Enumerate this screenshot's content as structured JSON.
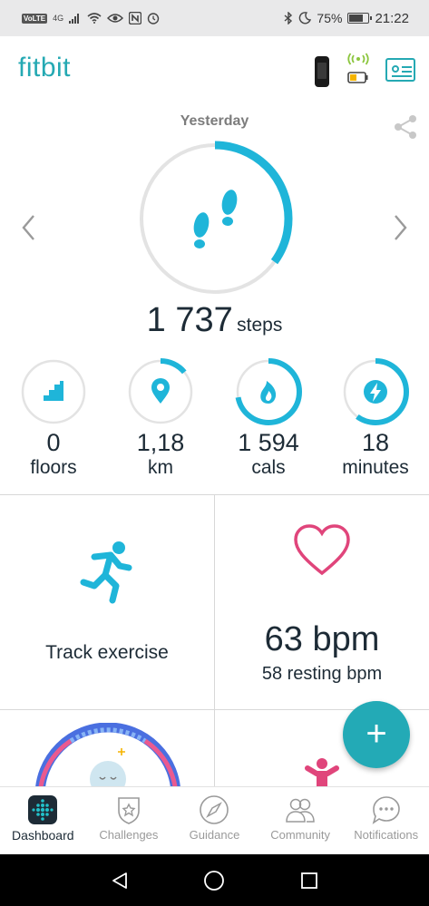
{
  "status_bar": {
    "volte": "VoLTE",
    "network": "4G",
    "battery_percent": "75%",
    "battery_level": 0.75,
    "time": "21:22"
  },
  "app": {
    "logo": "fitbit",
    "brand_color": "#25a9b3"
  },
  "summary": {
    "period": "Yesterday",
    "steps_value": "1 737",
    "steps_unit": "steps",
    "steps_progress": 0.35
  },
  "stats": [
    {
      "value": "0",
      "unit": "floors",
      "icon": "stairs-icon",
      "progress": 0.0
    },
    {
      "value": "1,18",
      "unit": "km",
      "icon": "location-pin-icon",
      "progress": 0.14
    },
    {
      "value": "1 594",
      "unit": "cals",
      "icon": "flame-icon",
      "progress": 0.72
    },
    {
      "value": "18",
      "unit": "minutes",
      "icon": "lightning-icon",
      "progress": 0.6
    }
  ],
  "tiles": {
    "exercise_label": "Track exercise",
    "heart_bpm": "63 bpm",
    "heart_resting": "58 resting bpm"
  },
  "fab": {
    "label": "+"
  },
  "bottom_nav": [
    {
      "label": "Dashboard",
      "icon": "dashboard-icon",
      "active": true
    },
    {
      "label": "Challenges",
      "icon": "challenges-icon",
      "active": false
    },
    {
      "label": "Guidance",
      "icon": "compass-icon",
      "active": false
    },
    {
      "label": "Community",
      "icon": "community-icon",
      "active": false
    },
    {
      "label": "Notifications",
      "icon": "notifications-icon",
      "active": false
    }
  ],
  "colors": {
    "accent": "#1fb5d9",
    "ring_track": "#e3e3e3",
    "heart": "#e0457b",
    "fab": "#23aab6"
  }
}
